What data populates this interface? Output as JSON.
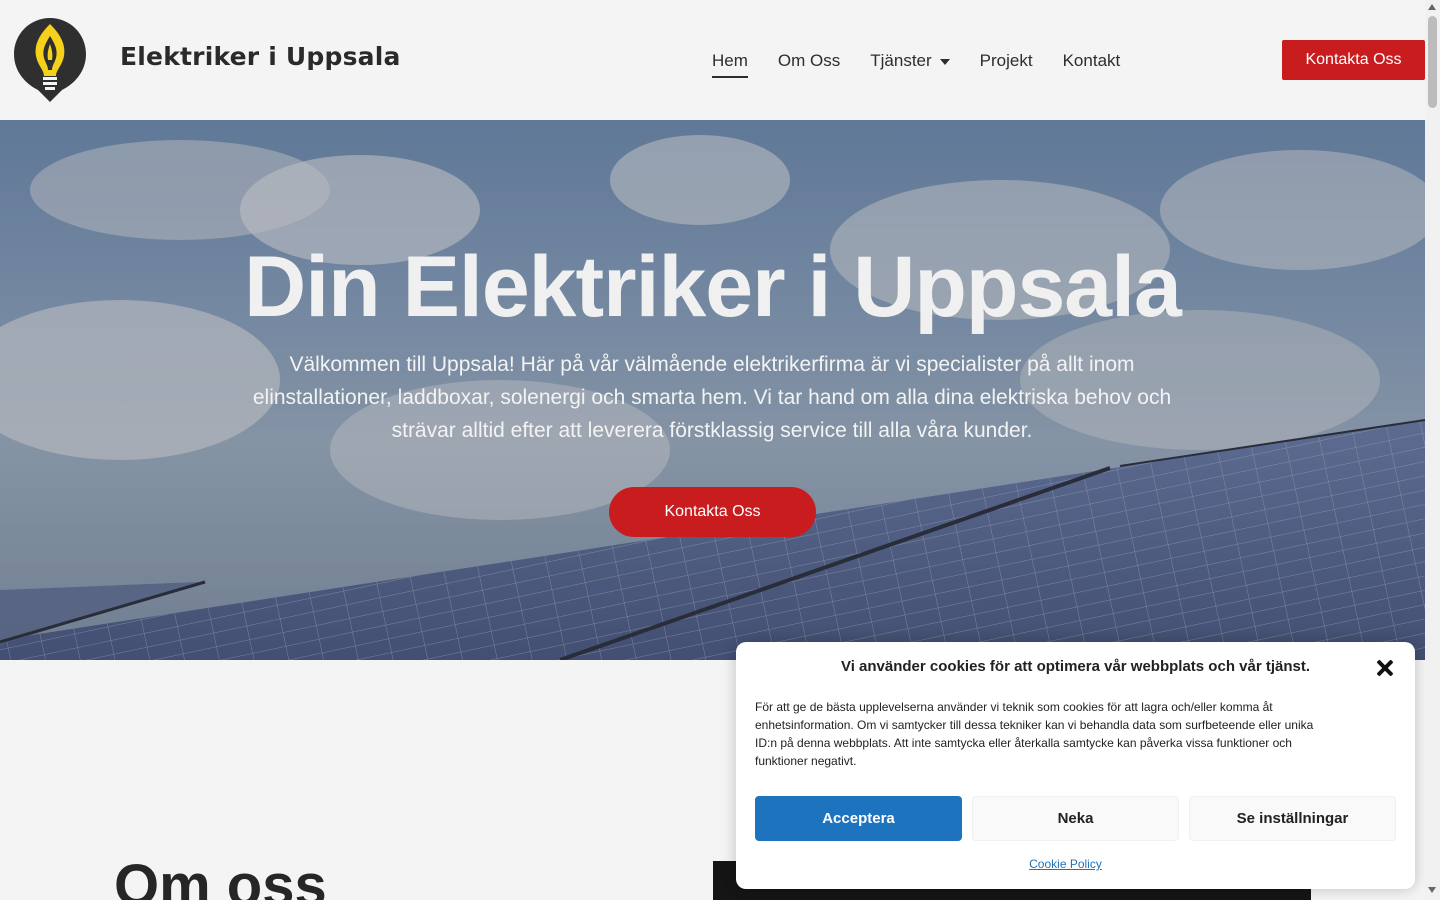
{
  "header": {
    "site_title": "Elektriker i Uppsala",
    "nav": [
      {
        "label": "Hem",
        "active": true
      },
      {
        "label": "Om Oss"
      },
      {
        "label": "Tjänster",
        "has_dropdown": true
      },
      {
        "label": "Projekt"
      },
      {
        "label": "Kontakt"
      }
    ],
    "cta_label": "Kontakta Oss"
  },
  "hero": {
    "title": "Din Elektriker i Uppsala",
    "text": "Välkommen till Uppsala! Här på vår välmående elektrikerfirma är vi specialister på allt inom elinstallationer, laddboxar, solenergi och smarta hem. Vi tar hand om alla dina elektriska behov och strävar alltid efter att leverera förstklassig service till alla våra kunder.",
    "cta_label": "Kontakta Oss"
  },
  "about": {
    "title": "Om oss"
  },
  "cookie_banner": {
    "title": "Vi använder cookies för att optimera vår webbplats och vår tjänst.",
    "text": "För att ge de bästa upplevelserna använder vi teknik som cookies för att lagra och/eller komma åt enhetsinformation. Om vi samtycker till dessa tekniker kan vi behandla data som surfbeteende eller unika ID:n på denna webbplats. Att inte samtycka eller återkalla samtycke kan påverka vissa funktioner och funktioner negativt.",
    "accept_label": "Acceptera",
    "deny_label": "Neka",
    "settings_label": "Se inställningar",
    "policy_link": "Cookie Policy"
  },
  "colors": {
    "brand_red": "#c91c1f",
    "accept_blue": "#1e73be",
    "logo_yellow": "#f5d11b",
    "logo_dark": "#2f2f2f"
  },
  "icons": {
    "logo": "lightbulb-flame-icon",
    "dropdown": "caret-down-icon",
    "close": "close-icon"
  }
}
